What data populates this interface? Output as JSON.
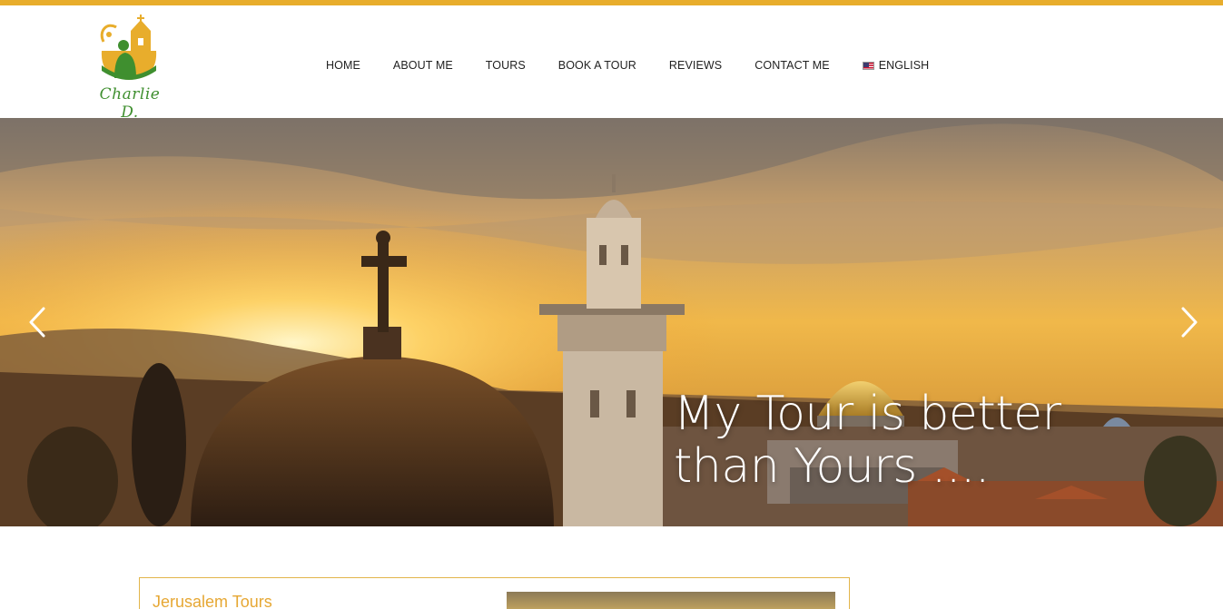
{
  "brand": {
    "logo_text": "Charlie D.",
    "accent_color": "#e8ad2c",
    "logo_green": "#3f8f2f"
  },
  "nav": {
    "items": [
      {
        "label": "HOME"
      },
      {
        "label": "ABOUT ME"
      },
      {
        "label": "TOURS"
      },
      {
        "label": "BOOK A TOUR"
      },
      {
        "label": "REVIEWS"
      },
      {
        "label": "CONTACT ME"
      }
    ],
    "language": {
      "label": "ENGLISH",
      "icon": "us-flag-icon"
    }
  },
  "hero": {
    "caption_line1": "My Tour is better",
    "caption_line2": "than Yours ....",
    "prev_icon": "chevron-left-icon",
    "next_icon": "chevron-right-icon"
  },
  "content": {
    "card_title": "Jerusalem Tours"
  }
}
